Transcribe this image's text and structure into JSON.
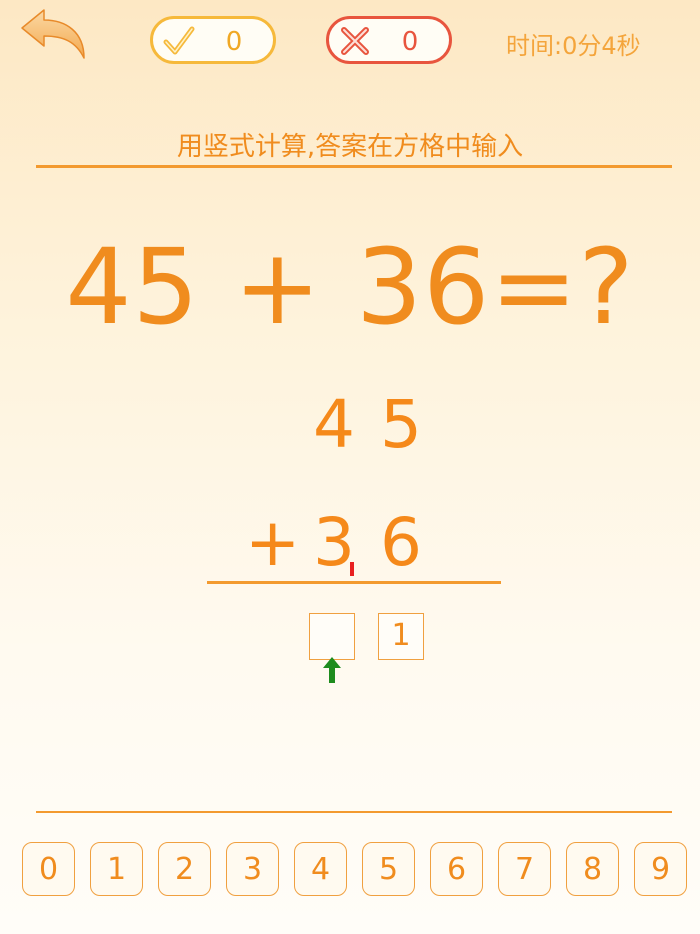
{
  "header": {
    "correct_count": "0",
    "wrong_count": "0",
    "timer_text": "时间:0分4秒"
  },
  "instruction": "用竖式计算,答案在方格中输入",
  "equation": "45 + 36=?",
  "vertical": {
    "top_number": "4 5",
    "operator": "+",
    "bottom_number": "3 6",
    "answer_tens": "",
    "answer_ones": "1"
  },
  "keypad": [
    "0",
    "1",
    "2",
    "3",
    "4",
    "5",
    "6",
    "7",
    "8",
    "9"
  ],
  "colors": {
    "accent": "#f08c1e",
    "correct": "#f6b93b",
    "wrong": "#e8553e",
    "carry_mark": "#e82020",
    "arrow": "#1e8c1e"
  }
}
